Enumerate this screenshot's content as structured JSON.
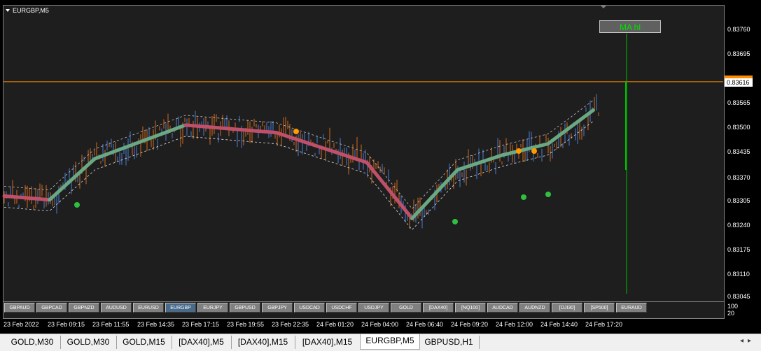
{
  "window": {
    "title": "EURGBP,M5"
  },
  "price_axis": {
    "ticks": [
      "0.83760",
      "0.83695",
      "0.83616",
      "0.83565",
      "0.83500",
      "0.83435",
      "0.83370",
      "0.83305",
      "0.83240",
      "0.83175",
      "0.83110",
      "0.83045"
    ],
    "current_price": "0.83616"
  },
  "sub_scale": {
    "top": "100",
    "bottom": "20"
  },
  "time_axis": [
    "23 Feb 2022",
    "23 Feb 09:15",
    "23 Feb 11:55",
    "23 Feb 14:35",
    "23 Feb 17:15",
    "23 Feb 19:55",
    "23 Feb 22:35",
    "24 Feb 01:20",
    "24 Feb 04:00",
    "24 Feb 06:40",
    "24 Feb 09:20",
    "24 Feb 12:00",
    "24 Feb 14:40",
    "24 Feb 17:20"
  ],
  "symbol_buttons": [
    {
      "label": "GBPAUD"
    },
    {
      "label": "GBPCAD"
    },
    {
      "label": "GBPNZD"
    },
    {
      "label": "AUDUSD"
    },
    {
      "label": "EURUSD"
    },
    {
      "label": "EURGBP",
      "active": true
    },
    {
      "label": "EURJPY"
    },
    {
      "label": "GBPUSD"
    },
    {
      "label": "GBPJPY"
    },
    {
      "label": "USDCAD"
    },
    {
      "label": "USDCHF"
    },
    {
      "label": "USDJPY"
    },
    {
      "label": "GOLD"
    },
    {
      "label": "[DAX40]"
    },
    {
      "label": "[NQ100]"
    },
    {
      "label": "AUDCAD"
    },
    {
      "label": "AUDNZD"
    },
    {
      "label": "[DJI30]"
    },
    {
      "label": "[SP500]"
    },
    {
      "label": "EURAUD"
    }
  ],
  "indicator_box": {
    "label": "MA hl"
  },
  "tabs": [
    {
      "label": "GOLD,M30"
    },
    {
      "label": "GOLD,M30"
    },
    {
      "label": "GOLD,M15"
    },
    {
      "label": "[DAX40],M5"
    },
    {
      "label": "[DAX40],M15"
    },
    {
      "label": "[DAX40],M15"
    },
    {
      "label": "EURGBP,M5",
      "active": true
    },
    {
      "label": "GBPUSD,H1"
    }
  ],
  "colors": {
    "background": "#1e1e1e",
    "bull": "#4a7fd4",
    "bear": "#d2691e",
    "ma_up": "#6aa884",
    "ma_down": "#c0506a",
    "price_line": "#ff8c00",
    "ma_box_text": "#00e000"
  },
  "chart_data": {
    "type": "line",
    "symbol": "EURGBP",
    "timeframe": "M5",
    "x": [
      "23 Feb 2022",
      "23 Feb 09:15",
      "23 Feb 11:55",
      "23 Feb 14:35",
      "23 Feb 17:15",
      "23 Feb 19:55",
      "23 Feb 22:35",
      "24 Feb 01:20",
      "24 Feb 04:00",
      "24 Feb 06:40",
      "24 Feb 09:20",
      "24 Feb 12:00",
      "24 Feb 14:40",
      "24 Feb 17:20"
    ],
    "series": [
      {
        "values": [
          0.8331,
          0.833,
          0.8341,
          0.83455,
          0.835,
          0.8349,
          0.8348,
          0.8344,
          0.834,
          0.8325,
          0.8338,
          0.8342,
          0.8345,
          0.8354
        ]
      }
    ],
    "ylim": [
      0.83045,
      0.8376
    ],
    "current_price": 0.83616,
    "grid": false
  }
}
